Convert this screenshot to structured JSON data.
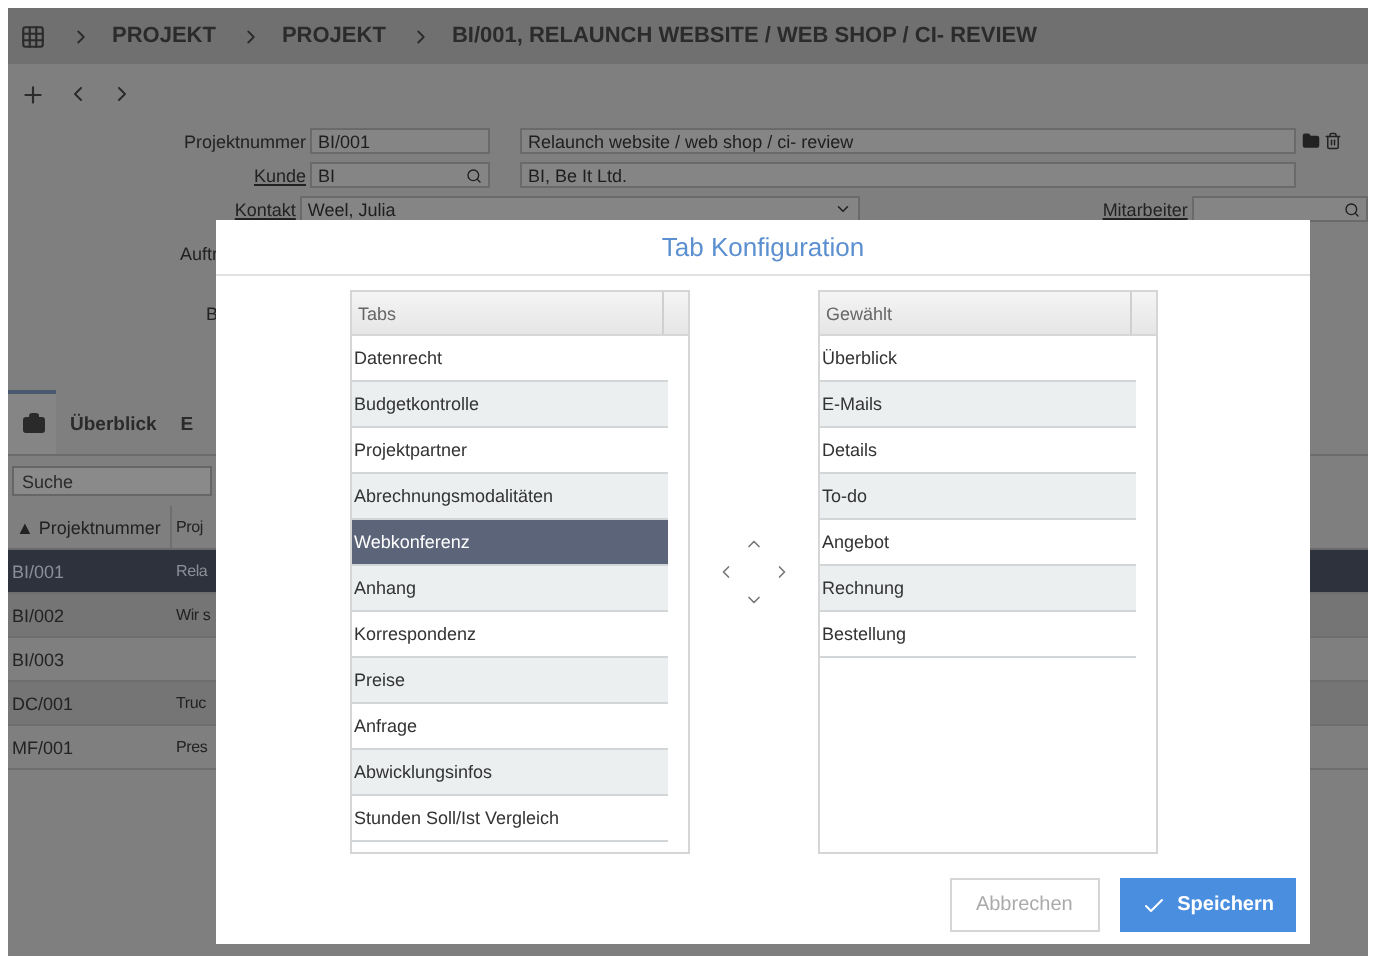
{
  "breadcrumbs": [
    "PROJEKT",
    "PROJEKT",
    "BI/001, RELAUNCH WEBSITE / WEB SHOP / CI- REVIEW"
  ],
  "form": {
    "projektnummer": {
      "label": "Projektnummer",
      "value": "BI/001",
      "description": "Relaunch website / web shop / ci- review"
    },
    "kunde": {
      "label": "Kunde",
      "value": "BI",
      "description": "BI, Be It Ltd."
    },
    "kontakt": {
      "label": "Kontakt",
      "value": "Weel, Julia"
    },
    "mitarbeiter": {
      "label": "Mitarbeiter"
    },
    "cut_labels": [
      "Auftr",
      "B"
    ]
  },
  "tabs": [
    {
      "kind": "icon",
      "selected": true
    },
    {
      "kind": "text",
      "label": "Überblick",
      "selected": false
    },
    {
      "kind": "text",
      "label": "E",
      "selected": false
    }
  ],
  "search": {
    "placeholder": "Suche"
  },
  "table": {
    "columns": [
      "▲ Projektnummer",
      "Proj"
    ],
    "rows": [
      {
        "cells": [
          "BI/001",
          "Rela"
        ],
        "selected": true
      },
      {
        "cells": [
          "BI/002",
          "Wir s"
        ],
        "selected": false
      },
      {
        "cells": [
          "BI/003"
        ],
        "selected": false
      },
      {
        "cells": [
          "DC/001",
          "Truc"
        ],
        "selected": false
      },
      {
        "cells": [
          "MF/001",
          "Pres"
        ],
        "selected": false
      }
    ]
  },
  "dialog": {
    "title": "Tab Konfiguration",
    "available": {
      "header": "Tabs",
      "items": [
        {
          "label": "Datenrecht",
          "selected": false
        },
        {
          "label": "Budgetkontrolle",
          "selected": false
        },
        {
          "label": "Projektpartner",
          "selected": false
        },
        {
          "label": "Abrechnungsmodalitäten",
          "selected": false
        },
        {
          "label": "Webkonferenz",
          "selected": true
        },
        {
          "label": "Anhang",
          "selected": false
        },
        {
          "label": "Korrespondenz",
          "selected": false
        },
        {
          "label": "Preise",
          "selected": false
        },
        {
          "label": "Anfrage",
          "selected": false
        },
        {
          "label": "Abwicklungsinfos",
          "selected": false
        },
        {
          "label": "Stunden Soll/Ist Vergleich",
          "selected": false
        }
      ]
    },
    "chosen": {
      "header": "Gewählt",
      "items": [
        {
          "label": "Überblick",
          "selected": false
        },
        {
          "label": "E-Mails",
          "selected": false
        },
        {
          "label": "Details",
          "selected": false
        },
        {
          "label": "To-do",
          "selected": false
        },
        {
          "label": "Angebot",
          "selected": false
        },
        {
          "label": "Rechnung",
          "selected": false
        },
        {
          "label": "Bestellung",
          "selected": false
        }
      ]
    },
    "buttons": [
      {
        "kind": "secondary",
        "label": "Abbrechen"
      },
      {
        "kind": "primary",
        "label": "Speichern"
      }
    ]
  }
}
